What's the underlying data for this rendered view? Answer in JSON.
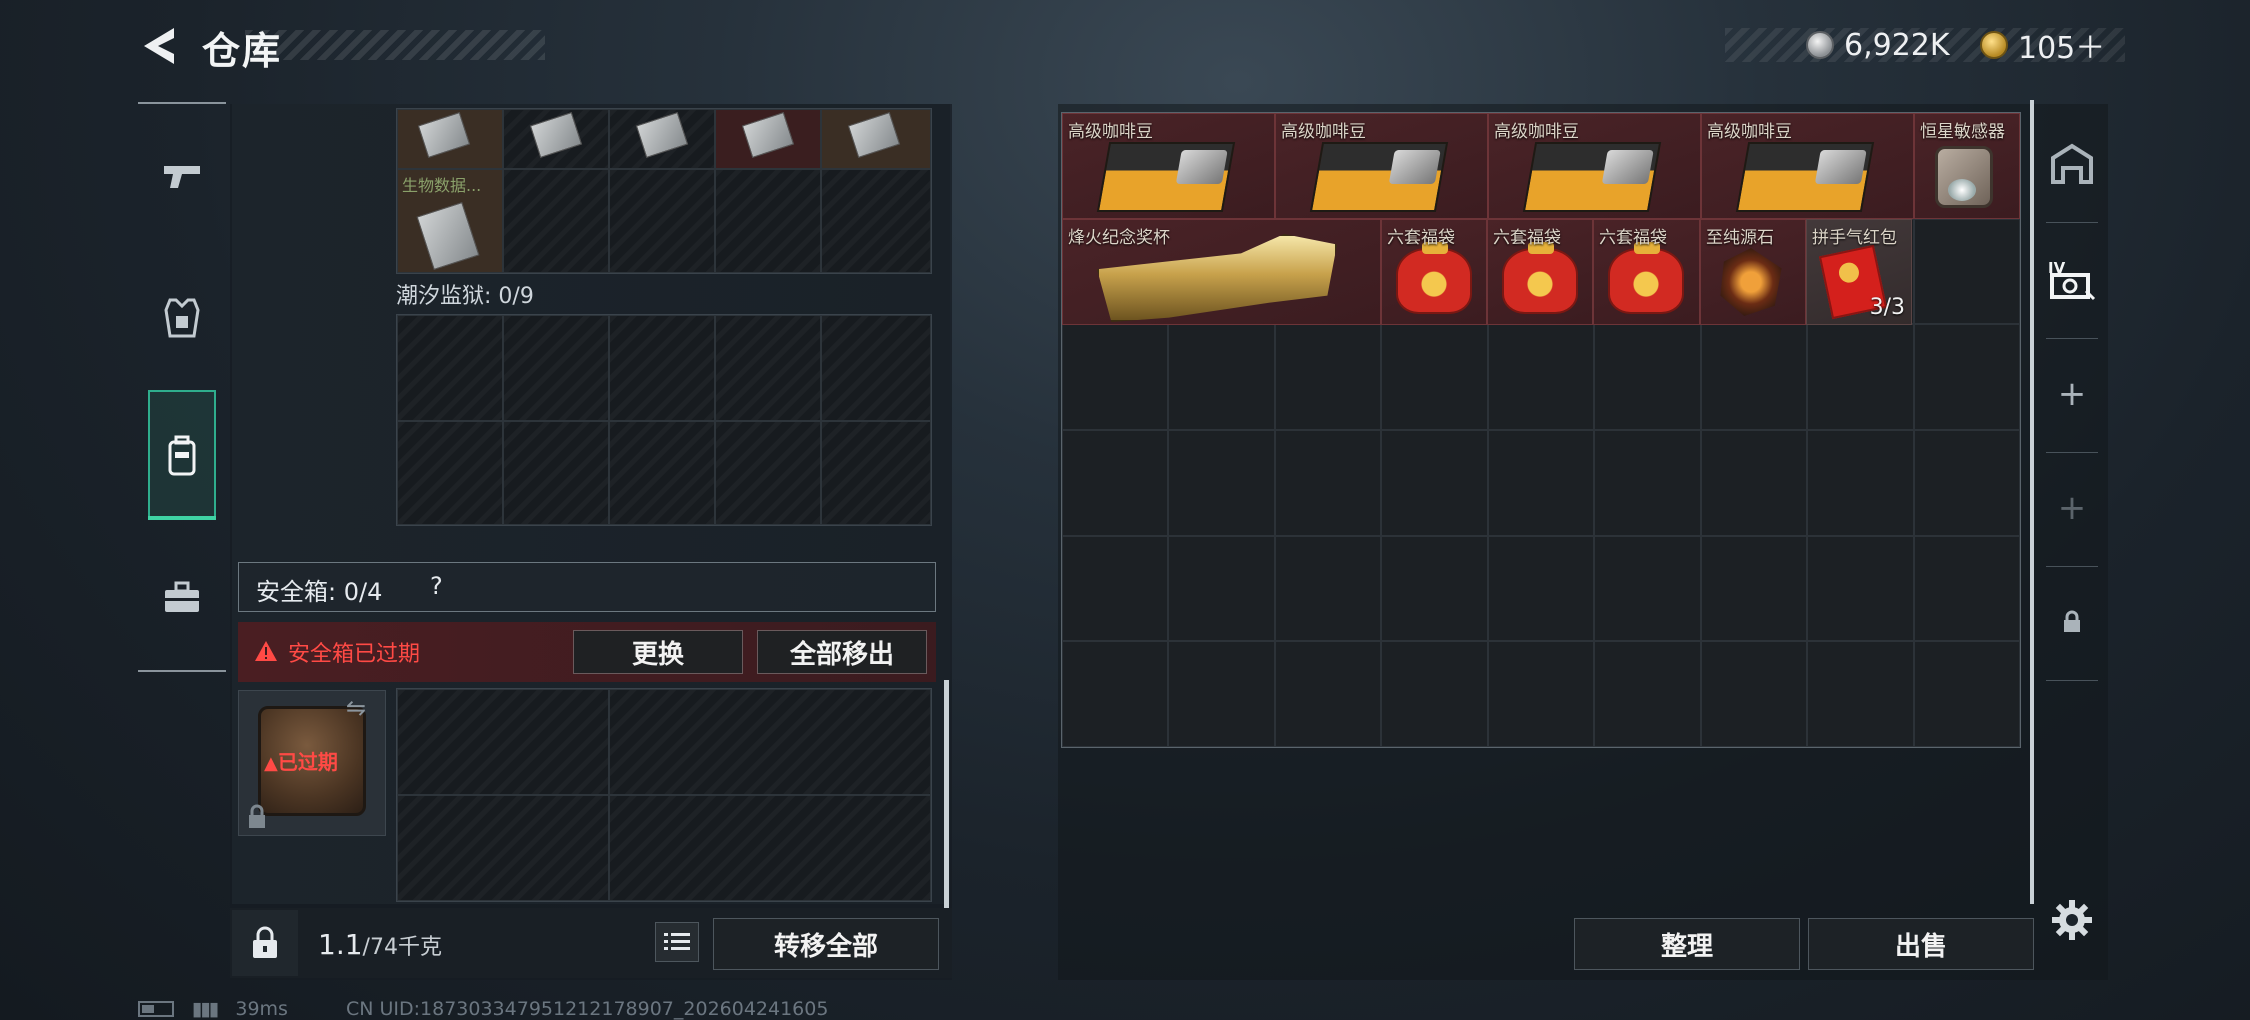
{
  "header": {
    "title": "仓库",
    "currencies": [
      {
        "name": "silver-coin-icon",
        "value": "6,922K"
      },
      {
        "name": "gold-coin-icon",
        "value": "105＋"
      }
    ]
  },
  "left_rail": {
    "items": [
      {
        "icon": "pistol-icon"
      },
      {
        "icon": "armor-vest-icon"
      },
      {
        "icon": "backpack-icon",
        "active": true
      },
      {
        "icon": "toolbox-icon"
      }
    ]
  },
  "left_panel": {
    "top_items": [
      {
        "label": "生物数据..."
      }
    ],
    "prison": {
      "label": "潮汐监狱: 0/9"
    },
    "safe_box": {
      "label": "安全箱: 0/4",
      "help": "?",
      "expired_notice": "安全箱已过期",
      "replace_button": "更换",
      "move_all_button": "全部移出",
      "case_status": "已过期"
    },
    "footer": {
      "weight_value": "1.1",
      "weight_unit": "/74千克",
      "transfer_all_button": "转移全部"
    }
  },
  "stash": {
    "items": [
      {
        "name": "高级咖啡豆",
        "kind": "coffee",
        "rarity": "red"
      },
      {
        "name": "高级咖啡豆",
        "kind": "coffee",
        "rarity": "red"
      },
      {
        "name": "高级咖啡豆",
        "kind": "coffee",
        "rarity": "red"
      },
      {
        "name": "高级咖啡豆",
        "kind": "coffee",
        "rarity": "red"
      },
      {
        "name": "恒星敏感器",
        "kind": "sensor",
        "rarity": "red"
      },
      {
        "name": "烽火纪念奖杯",
        "kind": "cup",
        "rarity": "red"
      },
      {
        "name": "六套福袋",
        "kind": "bag",
        "rarity": "red"
      },
      {
        "name": "六套福袋",
        "kind": "bag",
        "rarity": "red"
      },
      {
        "name": "六套福袋",
        "kind": "bag",
        "rarity": "red"
      },
      {
        "name": "至纯源石",
        "kind": "stone",
        "rarity": "red"
      },
      {
        "name": "拼手气红包",
        "kind": "packet",
        "rarity": "gray",
        "count": "3/3"
      }
    ],
    "organize_button": "整理",
    "sell_button": "出售"
  },
  "right_rail": {
    "items": [
      {
        "icon": "warehouse-icon"
      },
      {
        "icon": "stash-tab-iv-icon"
      },
      {
        "icon": "add-icon",
        "glyph": "+"
      },
      {
        "icon": "add-icon-disabled",
        "glyph": "+"
      },
      {
        "icon": "lock-icon"
      }
    ]
  },
  "status": {
    "ping": "39ms",
    "uid": "CN UID:18730334795121217890​7_202604241605"
  },
  "colors": {
    "accent": "#3fd3a4",
    "warning_red": "#ff4a45",
    "item_red": "#4a2327"
  }
}
